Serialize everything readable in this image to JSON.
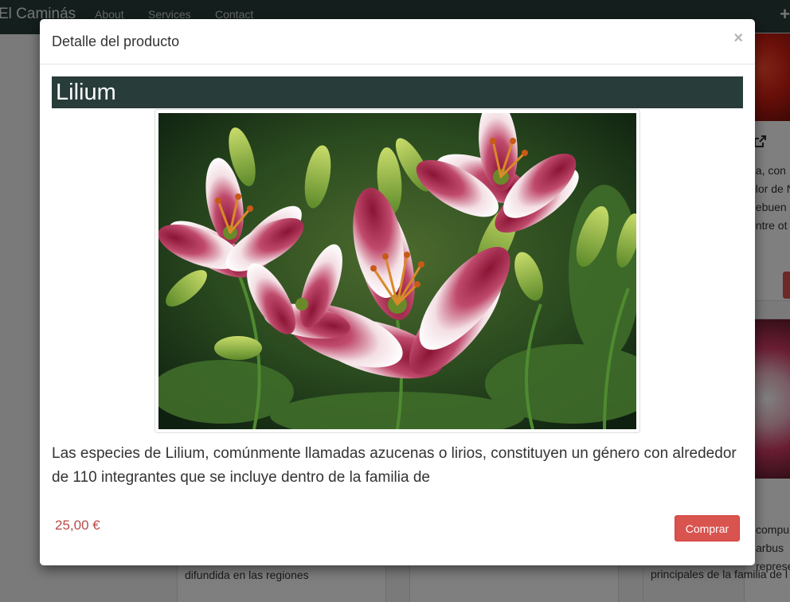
{
  "navbar": {
    "brand": "El Caminás",
    "links": [
      "About",
      "Services",
      "Contact"
    ],
    "add_label": "+"
  },
  "background_cards": {
    "right_top_text": [
      "na, con",
      "olor de N",
      "hebuen",
      "entre ot"
    ],
    "right_bottom_text": [
      "compu",
      "arbus",
      "represe",
      "principales de la familia de l"
    ],
    "left_bottom_text": "difundida en las regiones"
  },
  "modal": {
    "title": "Detalle del producto",
    "close_label": "×",
    "product": {
      "name": "Lilium",
      "image_alt": "lilium-flowers",
      "description": "Las especies de Lilium, comúnmente llamadas azucenas o lirios, constituyen un género con alrededor de 110 integrantes que se incluye dentro de la familia de",
      "price": "25,00 €",
      "buy_label": "Comprar"
    }
  },
  "colors": {
    "navbar_bg": "#283c3a",
    "title_bar_bg": "#283c3a",
    "price": "#b94a48",
    "buy_button": "#d9534f"
  }
}
